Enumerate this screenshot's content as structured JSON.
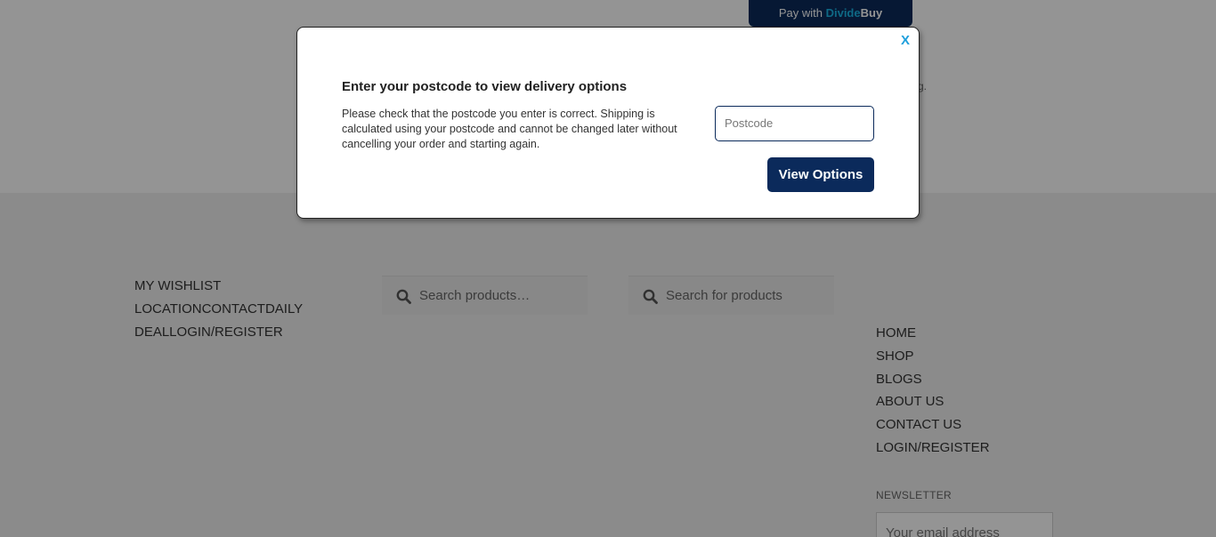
{
  "page": {
    "pay_button": {
      "prefix": "Pay with",
      "brand_part1": "Divide",
      "brand_part2": "Buy"
    },
    "stray_text": "g."
  },
  "footer": {
    "links_col1": [
      "MY WISHLIST",
      "LOCATIONCONTACTDAILY",
      "DEALLOGIN/REGISTER"
    ],
    "search1_placeholder": "Search products…",
    "search2_placeholder": "Search for products",
    "nav_links": [
      "HOME",
      "SHOP",
      "BLOGS",
      "ABOUT US",
      "CONTACT US",
      "LOGIN/REGISTER"
    ],
    "newsletter_label": "NEWSLETTER",
    "email_placeholder": "Your email address"
  },
  "modal": {
    "close_label": "X",
    "title": "Enter your postcode to view delivery options",
    "text": "Please check that the postcode you enter is correct. Shipping is calculated using your postcode and cannot be changed later without cancelling your order and starting again.",
    "postcode_placeholder": "Postcode",
    "postcode_value": "",
    "button_label": "View Options"
  },
  "colors": {
    "navy": "#0b2a5b",
    "accent_blue": "#1e9fdc",
    "overlay": "rgba(0,0,0,0.42)"
  }
}
